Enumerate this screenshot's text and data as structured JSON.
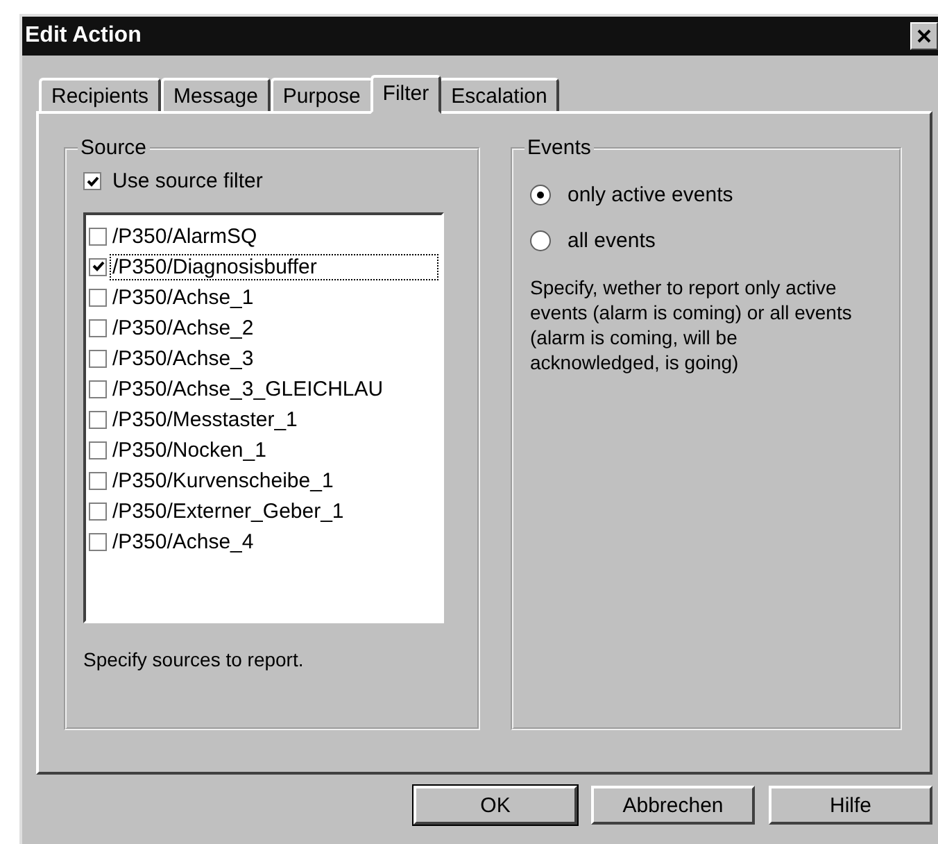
{
  "window": {
    "title": "Edit Action"
  },
  "tabs": [
    {
      "label": "Recipients",
      "selected": false
    },
    {
      "label": "Message",
      "selected": false
    },
    {
      "label": "Purpose",
      "selected": false
    },
    {
      "label": "Filter",
      "selected": true
    },
    {
      "label": "Escalation",
      "selected": false
    }
  ],
  "source": {
    "title": "Source",
    "use_filter": {
      "label": "Use source filter",
      "checked": true
    },
    "items": [
      {
        "label": "/P350/AlarmSQ",
        "checked": false,
        "focused": false
      },
      {
        "label": "/P350/Diagnosisbuffer",
        "checked": true,
        "focused": true
      },
      {
        "label": "/P350/Achse_1",
        "checked": false,
        "focused": false
      },
      {
        "label": "/P350/Achse_2",
        "checked": false,
        "focused": false
      },
      {
        "label": "/P350/Achse_3",
        "checked": false,
        "focused": false
      },
      {
        "label": "/P350/Achse_3_GLEICHLAU",
        "checked": false,
        "focused": false
      },
      {
        "label": "/P350/Messtaster_1",
        "checked": false,
        "focused": false
      },
      {
        "label": "/P350/Nocken_1",
        "checked": false,
        "focused": false
      },
      {
        "label": "/P350/Kurvenscheibe_1",
        "checked": false,
        "focused": false
      },
      {
        "label": "/P350/Externer_Geber_1",
        "checked": false,
        "focused": false
      },
      {
        "label": "/P350/Achse_4",
        "checked": false,
        "focused": false
      }
    ],
    "hint": "Specify sources to report."
  },
  "events": {
    "title": "Events",
    "options": [
      {
        "label": "only active events",
        "selected": true
      },
      {
        "label": "all events",
        "selected": false
      }
    ],
    "description": "Specify, wether to report only active events (alarm is coming) or all events (alarm is coming, will be acknowledged, is going)"
  },
  "buttons": [
    {
      "label": "OK",
      "default": true
    },
    {
      "label": "Abbrechen",
      "default": false
    },
    {
      "label": "Hilfe",
      "default": false
    }
  ]
}
